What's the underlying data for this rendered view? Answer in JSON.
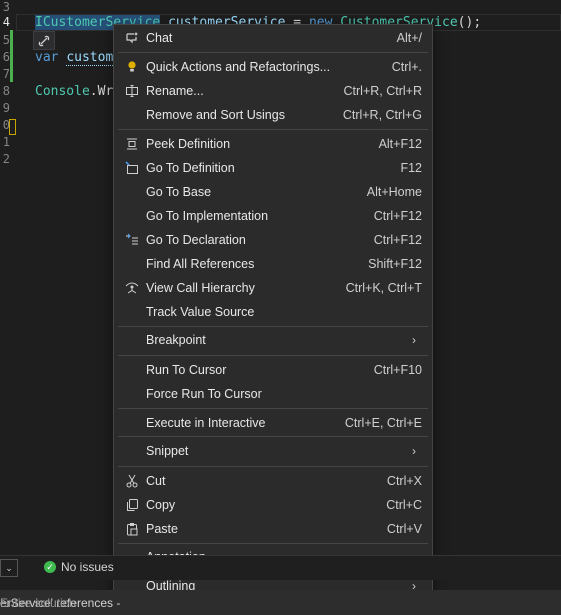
{
  "editor": {
    "line_numbers": [
      "3",
      "4",
      "5",
      "6",
      "7",
      "8",
      "9",
      "0",
      "1",
      "2"
    ],
    "line4": {
      "selected": "ICustomerService",
      "rest_ident": "customerService",
      "equals": " = ",
      "new_kw": "new",
      "type2": "CustomerService",
      "end": "();"
    },
    "line6": {
      "kw": "var",
      "ident": "custome"
    },
    "line8": {
      "type": "Console",
      "member": ".Wri"
    }
  },
  "context_menu": {
    "items": [
      {
        "label": "Chat",
        "shortcut": "Alt+/",
        "icon": "chat-sparkle-icon"
      },
      {
        "label": "Quick Actions and Refactorings...",
        "shortcut": "Ctrl+.",
        "icon": "lightbulb-icon"
      },
      {
        "label": "Rename...",
        "shortcut": "Ctrl+R, Ctrl+R",
        "icon": "rename-icon"
      },
      {
        "label": "Remove and Sort Usings",
        "shortcut": "Ctrl+R, Ctrl+G",
        "icon": ""
      },
      {
        "label": "Peek Definition",
        "shortcut": "Alt+F12",
        "icon": "peek-definition-icon"
      },
      {
        "label": "Go To Definition",
        "shortcut": "F12",
        "icon": "go-to-definition-icon"
      },
      {
        "label": "Go To Base",
        "shortcut": "Alt+Home",
        "icon": ""
      },
      {
        "label": "Go To Implementation",
        "shortcut": "Ctrl+F12",
        "icon": ""
      },
      {
        "label": "Go To Declaration",
        "shortcut": "Ctrl+F12",
        "icon": "go-to-declaration-icon"
      },
      {
        "label": "Find All References",
        "shortcut": "Shift+F12",
        "icon": ""
      },
      {
        "label": "View Call Hierarchy",
        "shortcut": "Ctrl+K, Ctrl+T",
        "icon": "call-hierarchy-icon"
      },
      {
        "label": "Track Value Source",
        "shortcut": "",
        "icon": ""
      },
      {
        "label": "Breakpoint",
        "shortcut": "",
        "icon": "",
        "submenu": true
      },
      {
        "label": "Run To Cursor",
        "shortcut": "Ctrl+F10",
        "icon": ""
      },
      {
        "label": "Force Run To Cursor",
        "shortcut": "",
        "icon": ""
      },
      {
        "label": "Execute in Interactive",
        "shortcut": "Ctrl+E, Ctrl+E",
        "icon": ""
      },
      {
        "label": "Snippet",
        "shortcut": "",
        "icon": "",
        "submenu": true
      },
      {
        "label": "Cut",
        "shortcut": "Ctrl+X",
        "icon": "scissors-icon"
      },
      {
        "label": "Copy",
        "shortcut": "Ctrl+C",
        "icon": "copy-icon"
      },
      {
        "label": "Paste",
        "shortcut": "Ctrl+V",
        "icon": "paste-icon"
      },
      {
        "label": "Annotation",
        "shortcut": "",
        "icon": "",
        "submenu": true
      },
      {
        "label": "Outlining",
        "shortcut": "",
        "icon": "",
        "submenu": true
      }
    ],
    "submenu_arrow": "›"
  },
  "statusbar": {
    "issues_text": "No issues",
    "check_glyph": "✓",
    "left_btn_glyph": "⌄"
  },
  "refbar": {
    "text": "erService' references - ",
    "muted": "Entire solution"
  },
  "colors": {
    "menu_bg": "#2b2b2b",
    "editor_bg": "#1e1e1e",
    "keyword": "#569cd6",
    "type": "#4ec9b0",
    "identifier": "#9cdcfe",
    "selection": "#264f78",
    "ok_green": "#3fb950"
  }
}
